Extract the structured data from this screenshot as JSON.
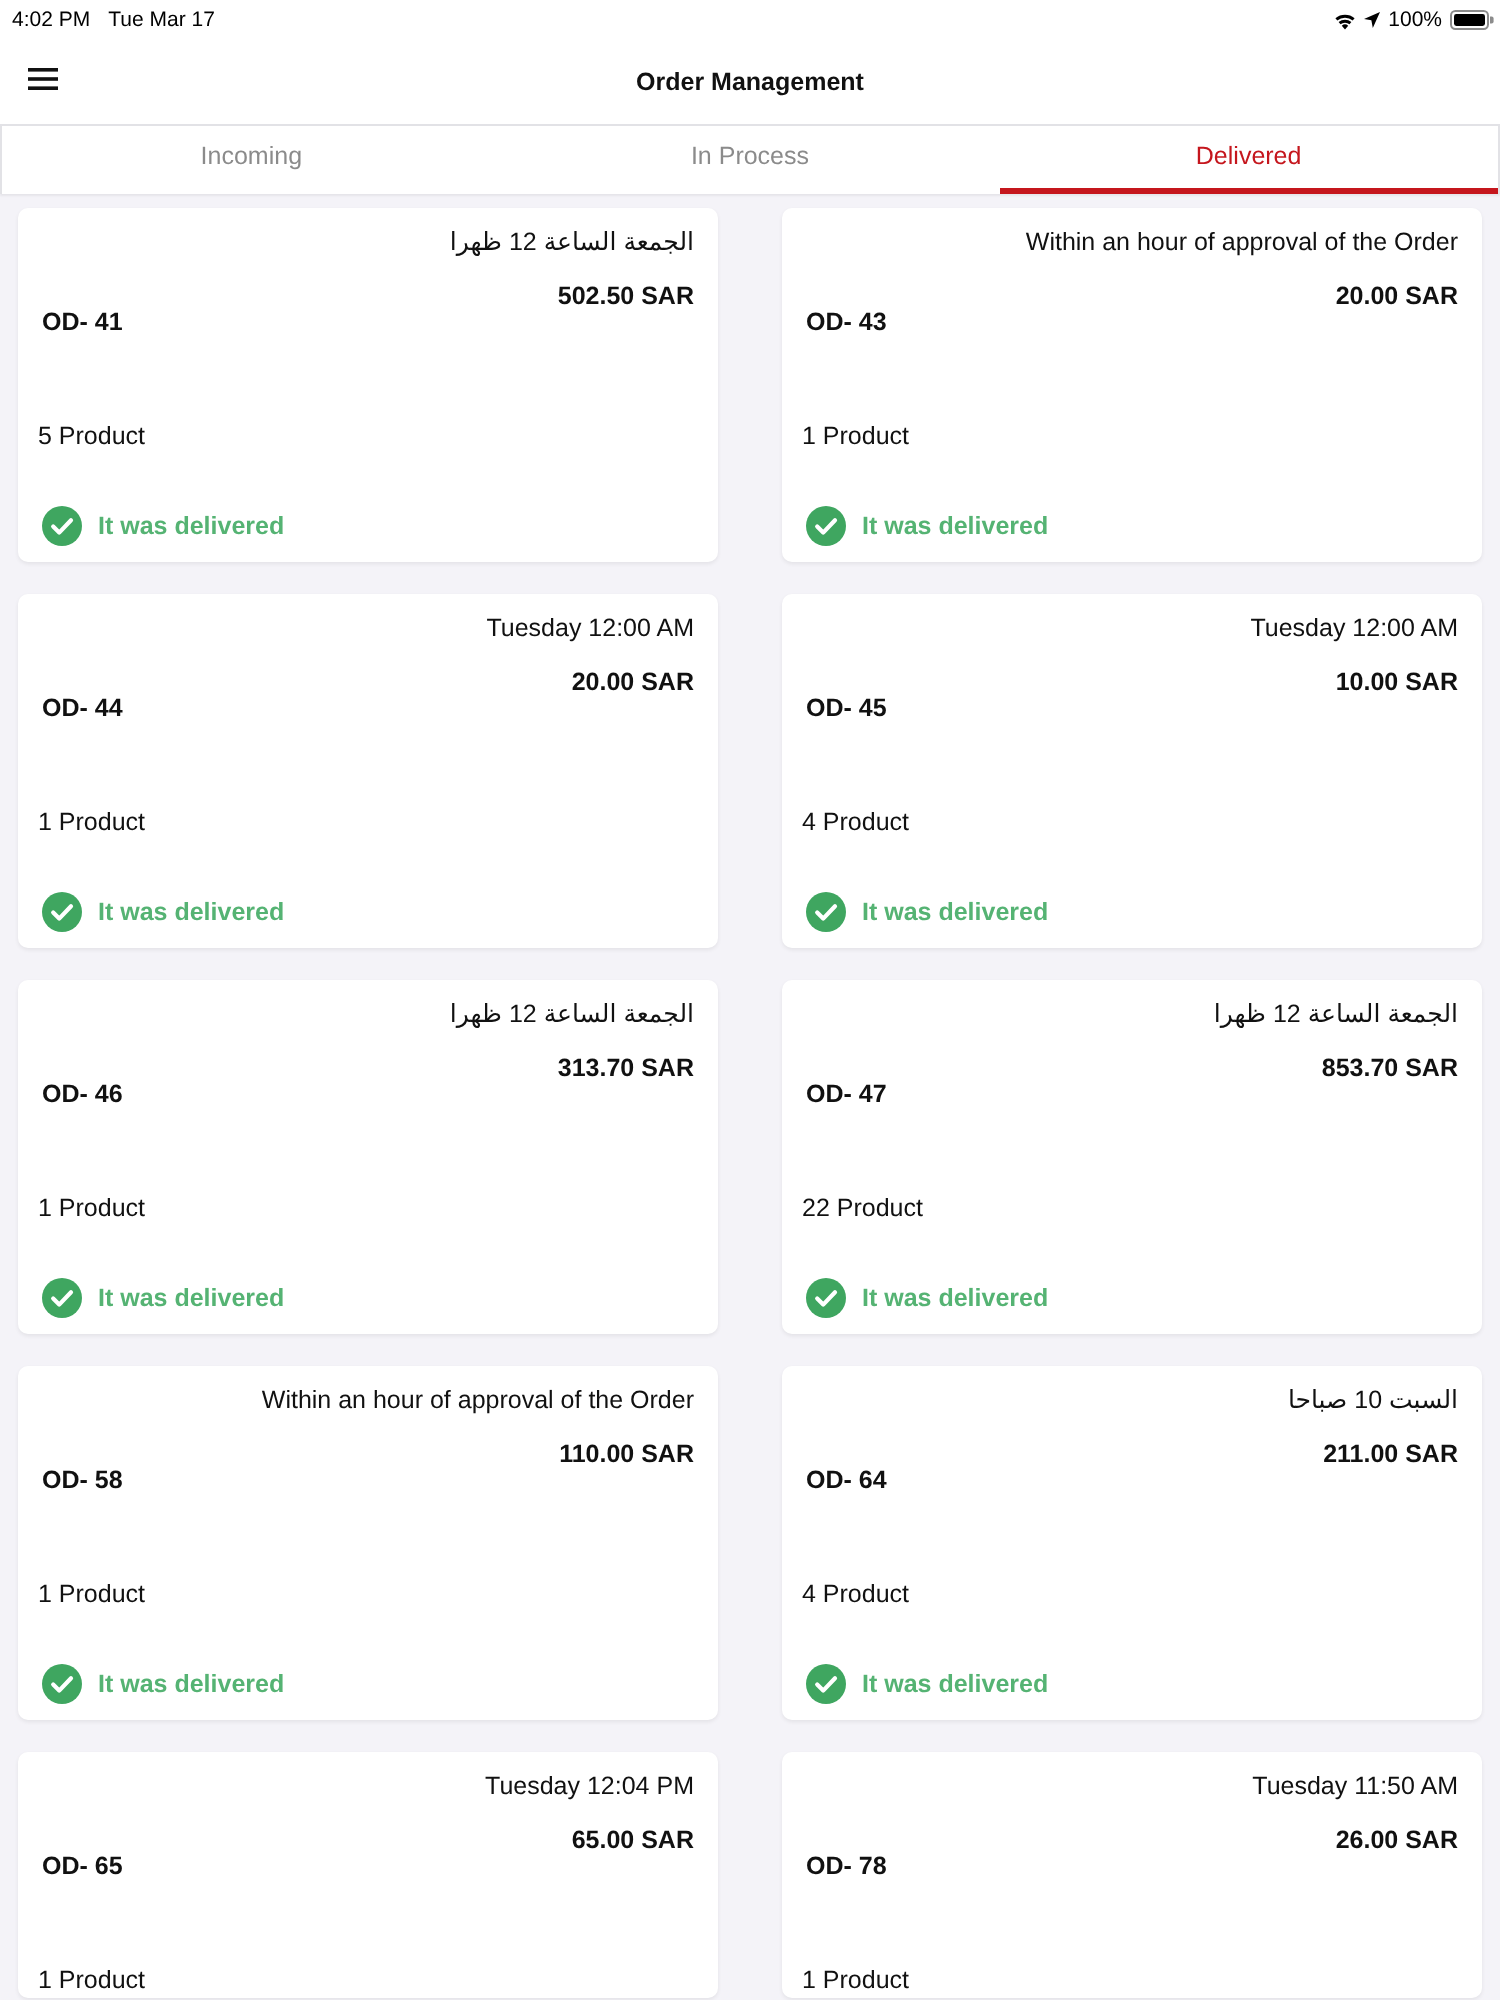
{
  "status_bar": {
    "time": "4:02 PM",
    "date": "Tue Mar 17",
    "battery": "100%"
  },
  "header": {
    "title": "Order Management"
  },
  "tabs": [
    {
      "label": "Incoming",
      "selected": false
    },
    {
      "label": "In Process",
      "selected": false
    },
    {
      "label": "Delivered",
      "selected": true
    }
  ],
  "orders": [
    {
      "delivery_time": "الجمعة الساعة 12 ظهرا",
      "total": "502.50 SAR",
      "order_id": "OD- 41",
      "products": "5 Product",
      "status": {
        "kind": "delivered",
        "text": "It was delivered"
      }
    },
    {
      "delivery_time": "Within an hour of approval of the Order",
      "total": "20.00 SAR",
      "order_id": "OD- 43",
      "products": "1 Product",
      "status": {
        "kind": "delivered",
        "text": "It was delivered"
      }
    },
    {
      "delivery_time": "Tuesday 12:00 AM",
      "total": "20.00 SAR",
      "order_id": "OD- 44",
      "products": "1 Product",
      "status": {
        "kind": "delivered",
        "text": "It was delivered"
      }
    },
    {
      "delivery_time": "Tuesday 12:00 AM",
      "total": "10.00 SAR",
      "order_id": "OD- 45",
      "products": "4 Product",
      "status": {
        "kind": "delivered",
        "text": "It was delivered"
      }
    },
    {
      "delivery_time": "الجمعة الساعة 12 ظهرا",
      "total": "313.70 SAR",
      "order_id": "OD- 46",
      "products": "1 Product",
      "status": {
        "kind": "delivered",
        "text": "It was delivered"
      }
    },
    {
      "delivery_time": "الجمعة الساعة 12 ظهرا",
      "total": "853.70 SAR",
      "order_id": "OD- 47",
      "products": "22 Product",
      "status": {
        "kind": "delivered",
        "text": "It was delivered"
      }
    },
    {
      "delivery_time": "Within an hour of approval of the Order",
      "total": "110.00 SAR",
      "order_id": "OD- 58",
      "products": "1 Product",
      "status": {
        "kind": "delivered",
        "text": "It was delivered"
      }
    },
    {
      "delivery_time": "السبت 10 صباحا",
      "total": "211.00 SAR",
      "order_id": "OD- 64",
      "products": "4 Product",
      "status": {
        "kind": "delivered",
        "text": "It was delivered"
      }
    },
    {
      "delivery_time": "Tuesday 12:04 PM",
      "total": "65.00 SAR",
      "order_id": "OD- 65",
      "products": "1 Product"
    },
    {
      "delivery_time": "Tuesday 11:50 AM",
      "total": "26.00 SAR",
      "order_id": "OD- 78",
      "products": "1 Product"
    }
  ]
}
